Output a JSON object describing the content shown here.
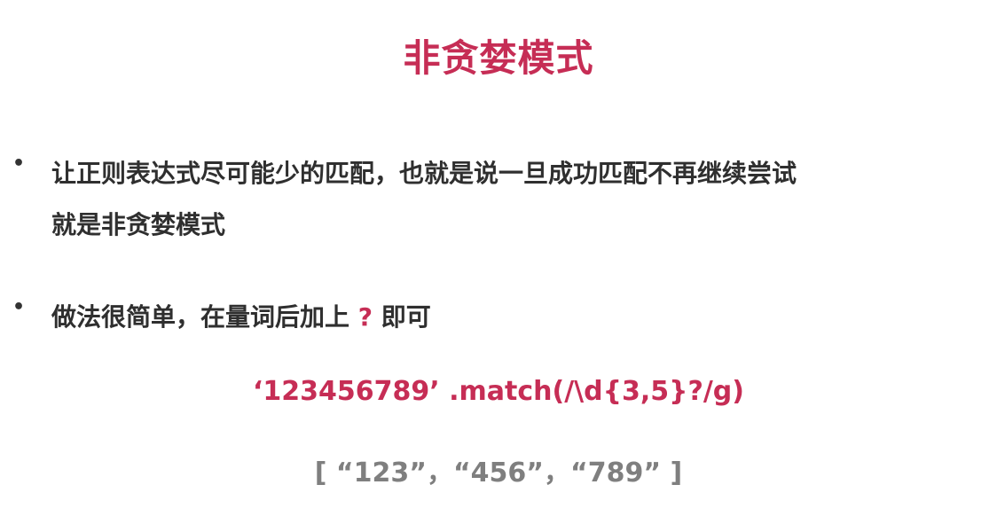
{
  "slide": {
    "title": "非贪婪模式",
    "bullets": [
      {
        "symbol": "•",
        "lines": [
          "让正则表达式尽可能少的匹配，也就是说一旦成功匹配不再继续尝试",
          "就是非贪婪模式"
        ]
      },
      {
        "symbol": "•",
        "text_before": "做法很简单，在量词后加上",
        "highlight": "?",
        "text_after": "即可"
      }
    ],
    "code": "‘123456789’ .match(/\\d{3,5}?/g)",
    "result": "[ “123”，“456”，“789” ]"
  },
  "colors": {
    "accent": "#c62d55",
    "body_text": "#2f2f2f",
    "result_text": "#7f7f7f",
    "background": "#ffffff"
  }
}
